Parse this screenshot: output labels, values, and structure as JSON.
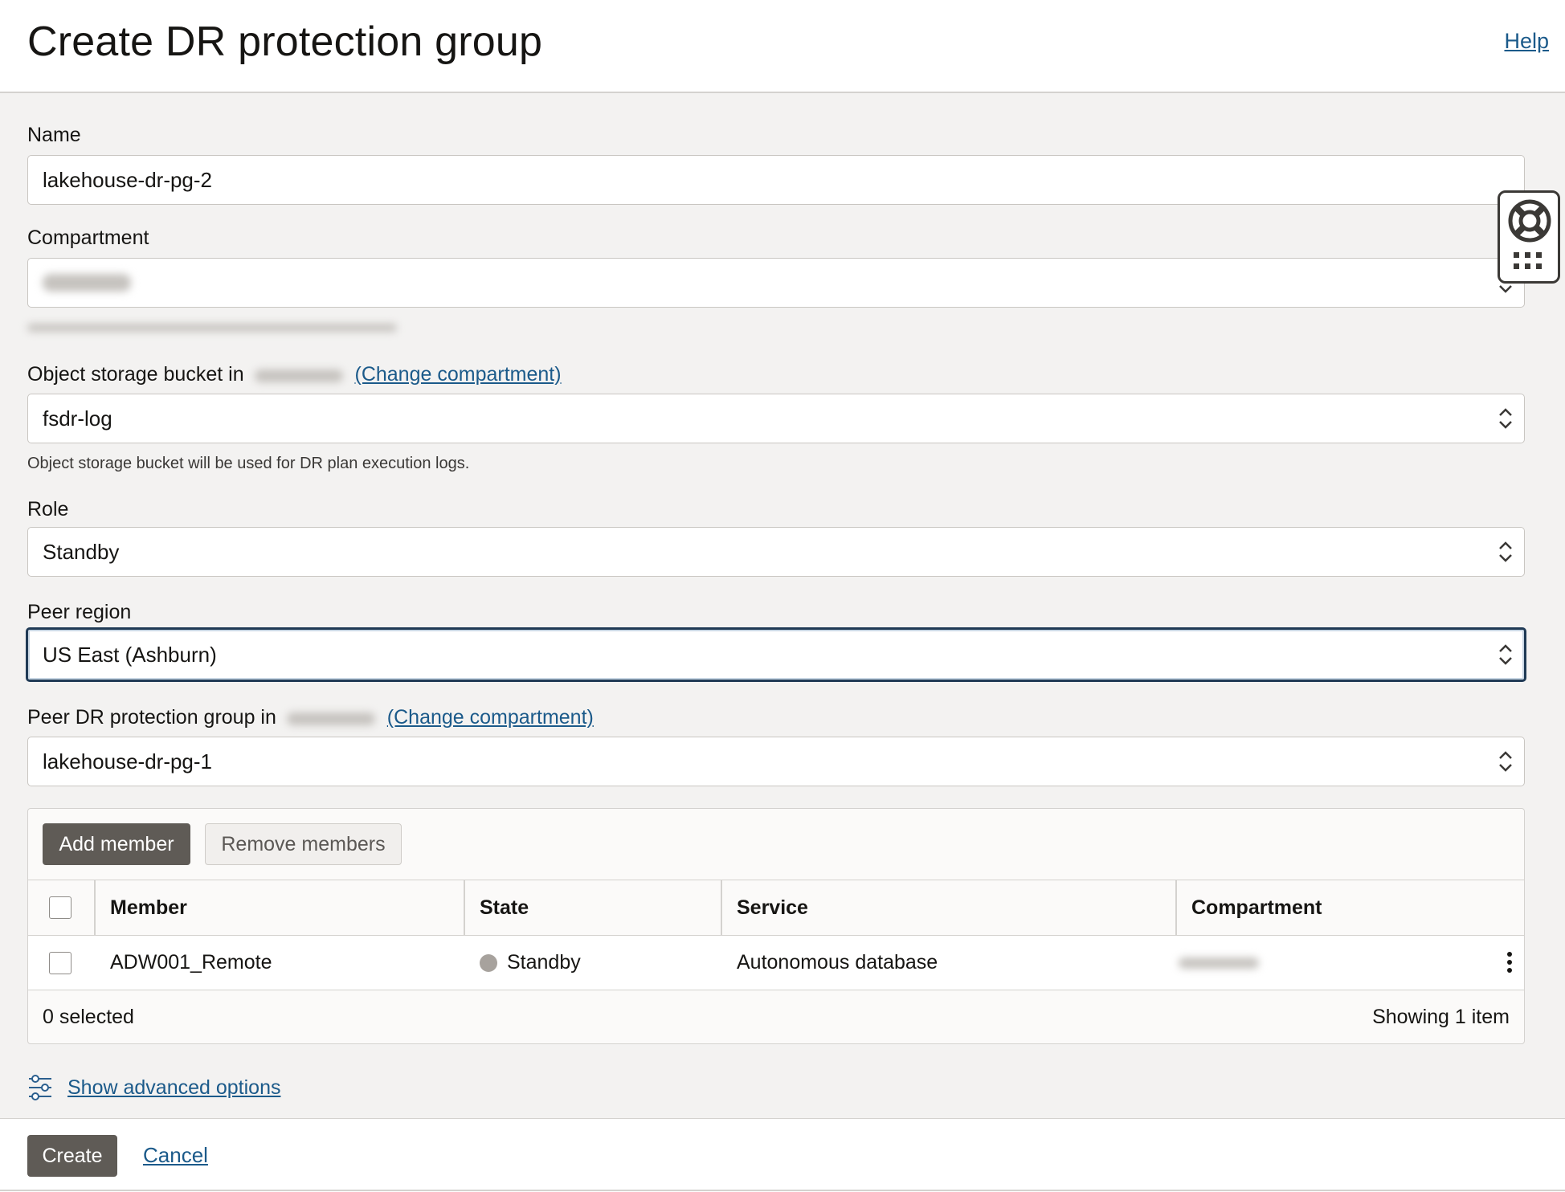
{
  "header": {
    "title": "Create DR protection group",
    "help_label": "Help"
  },
  "form": {
    "name": {
      "label": "Name",
      "value": "lakehouse-dr-pg-2"
    },
    "compartment": {
      "label": "Compartment",
      "value": ""
    },
    "bucket": {
      "label": "Object storage bucket in",
      "change_link": "(Change compartment)",
      "value": "fsdr-log",
      "hint": "Object storage bucket will be used for DR plan execution logs."
    },
    "role": {
      "label": "Role",
      "value": "Standby"
    },
    "peer_region": {
      "label": "Peer region",
      "value": "US East (Ashburn)"
    },
    "peer_group": {
      "label": "Peer DR protection group in",
      "change_link": "(Change compartment)",
      "value": "lakehouse-dr-pg-1"
    }
  },
  "members": {
    "add_button": "Add member",
    "remove_button": "Remove members",
    "columns": [
      "Member",
      "State",
      "Service",
      "Compartment"
    ],
    "rows": [
      {
        "member": "ADW001_Remote",
        "state": "Standby",
        "service": "Autonomous database",
        "compartment": ""
      }
    ],
    "selected_text": "0 selected",
    "count_text": "Showing 1 item"
  },
  "advanced_options_label": "Show advanced options",
  "footer": {
    "create_button": "Create",
    "cancel_link": "Cancel"
  },
  "icons": {
    "lifebuoy": "lifebuoy-icon",
    "apps": "apps-grid-icon",
    "settings": "sliders-icon",
    "chevrons": "chevron-up-down-icon",
    "kebab": "kebab-menu-icon"
  },
  "colors": {
    "primary_button": "#5f5b56",
    "link": "#1b5a8a",
    "focus_border": "#1f3a55",
    "standby_dot": "#a7a29d"
  }
}
